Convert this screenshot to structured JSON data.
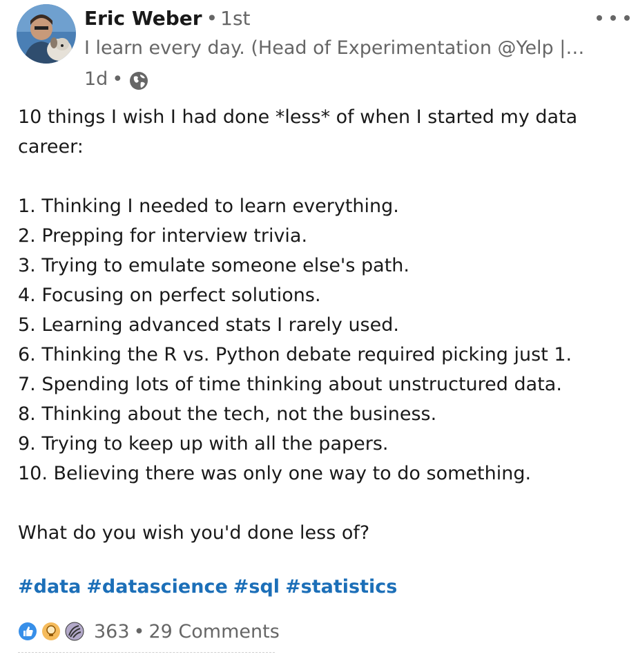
{
  "author": {
    "name": "Eric Weber",
    "degree": "1st",
    "headline": "I learn every day. (Head of Experimentation @Yelp |…",
    "time": "1d"
  },
  "post": {
    "lines": [
      "10 things I wish I had done *less* of when I started my data",
      "career:",
      "",
      "1. Thinking I needed to learn everything.",
      "2. Prepping for interview trivia.",
      "3. Trying to emulate someone else's path.",
      "4. Focusing on perfect solutions.",
      "5. Learning advanced stats I rarely used.",
      "6. Thinking the R vs. Python debate required picking just 1.",
      "7. Spending lots of time thinking about unstructured data.",
      "8. Thinking about the tech, not the business.",
      "9. Trying to keep up with all the papers.",
      "10. Believing there was only one way to do something.",
      "",
      "What do you wish you'd done less of?"
    ],
    "hashtags": [
      "#data",
      "#datascience",
      "#sql",
      "#statistics"
    ]
  },
  "social": {
    "reactions": [
      "like-icon",
      "insightful-icon",
      "curious-icon"
    ],
    "reaction_count": "363",
    "comments": "29 Comments"
  },
  "colors": {
    "text": "#191919",
    "secondary": "#666666",
    "link": "#1c6fb8"
  }
}
